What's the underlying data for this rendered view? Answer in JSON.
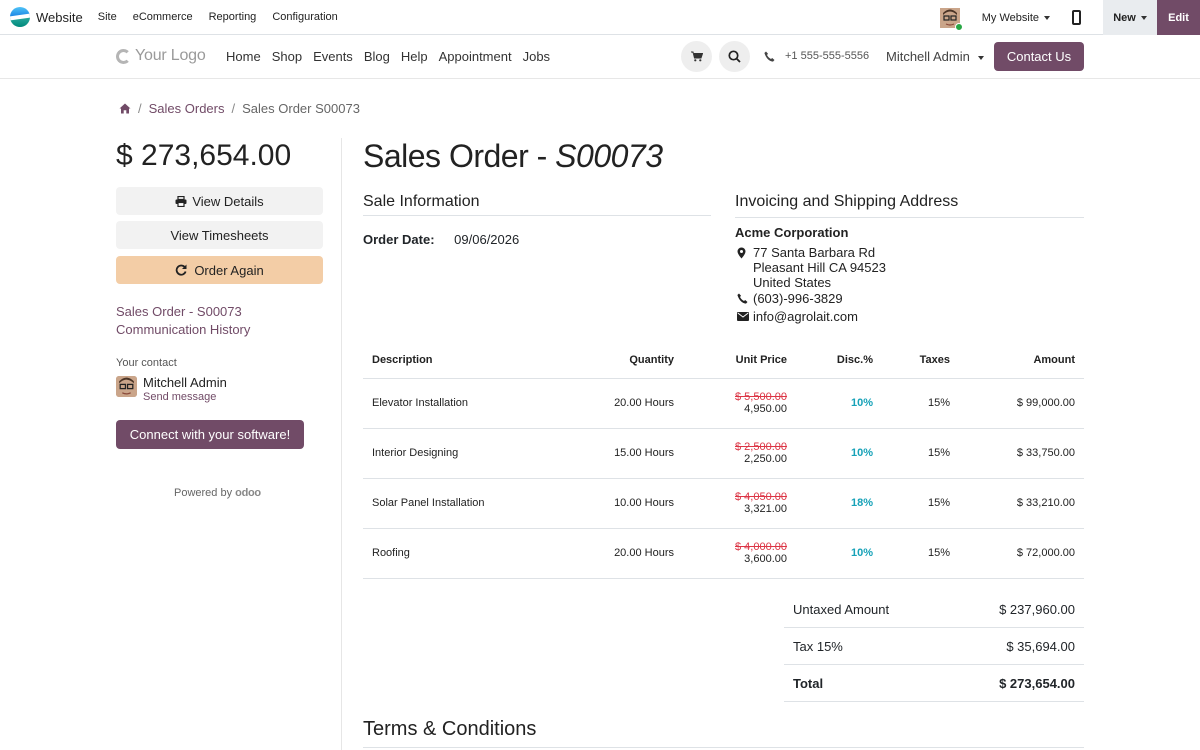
{
  "adminbar": {
    "brand": "Website",
    "menu": [
      "Site",
      "eCommerce",
      "Reporting",
      "Configuration"
    ],
    "my_website": "My Website",
    "new": "New",
    "edit": "Edit"
  },
  "header": {
    "logo": "Your Logo",
    "nav": [
      "Home",
      "Shop",
      "Events",
      "Blog",
      "Help",
      "Appointment",
      "Jobs"
    ],
    "phone": "+1 555-555-5556",
    "user": "Mitchell Admin",
    "contact_btn": "Contact Us"
  },
  "breadcrumb": {
    "level1": "Sales Orders",
    "level2": "Sales Order S00073",
    "sep": "/"
  },
  "sidebar": {
    "total": "$ 273,654.00",
    "view_details": "View Details",
    "view_timesheets": "View Timesheets",
    "order_again": "Order Again",
    "link1": "Sales Order - S00073",
    "link2": "Communication History",
    "contact_label": "Your contact",
    "contact_name": "Mitchell Admin",
    "contact_send": "Send message",
    "connect": "Connect with your software!",
    "powered_by": "Powered by",
    "powered_brand": "odoo"
  },
  "order": {
    "title_prefix": "Sales Order - ",
    "title_number": "S00073",
    "sale_info_heading": "Sale Information",
    "order_date_label": "Order Date:",
    "order_date": "09/06/2026",
    "address_heading": "Invoicing and Shipping Address",
    "company": "Acme Corporation",
    "street": "77 Santa Barbara Rd",
    "city": "Pleasant Hill CA 94523",
    "country": "United States",
    "phone": "(603)-996-3829",
    "email": "info@agrolait.com"
  },
  "table": {
    "headers": [
      "Description",
      "Quantity",
      "Unit Price",
      "Disc.%",
      "Taxes",
      "Amount"
    ],
    "rows": [
      {
        "description": "Elevator Installation",
        "quantity": "20.00 Hours",
        "old_price": "$ 5,500.00",
        "price": "4,950.00",
        "disc": "10%",
        "taxes": "15%",
        "amount": "$ 99,000.00"
      },
      {
        "description": "Interior Designing",
        "quantity": "15.00 Hours",
        "old_price": "$ 2,500.00",
        "price": "2,250.00",
        "disc": "10%",
        "taxes": "15%",
        "amount": "$ 33,750.00"
      },
      {
        "description": "Solar Panel Installation",
        "quantity": "10.00 Hours",
        "old_price": "$ 4,050.00",
        "price": "3,321.00",
        "disc": "18%",
        "taxes": "15%",
        "amount": "$ 33,210.00"
      },
      {
        "description": "Roofing",
        "quantity": "20.00 Hours",
        "old_price": "$ 4,000.00",
        "price": "3,600.00",
        "disc": "10%",
        "taxes": "15%",
        "amount": "$ 72,000.00"
      }
    ]
  },
  "totals": {
    "untaxed_label": "Untaxed Amount",
    "untaxed": "$ 237,960.00",
    "tax_label": "Tax 15%",
    "tax": "$ 35,694.00",
    "total_label": "Total",
    "total": "$ 273,654.00"
  },
  "terms_heading": "Terms & Conditions",
  "colors": {
    "brand": "#714b67",
    "order_again_bg": "#f3cda6",
    "discount": "#17a2b8",
    "strike": "#dc3545"
  }
}
